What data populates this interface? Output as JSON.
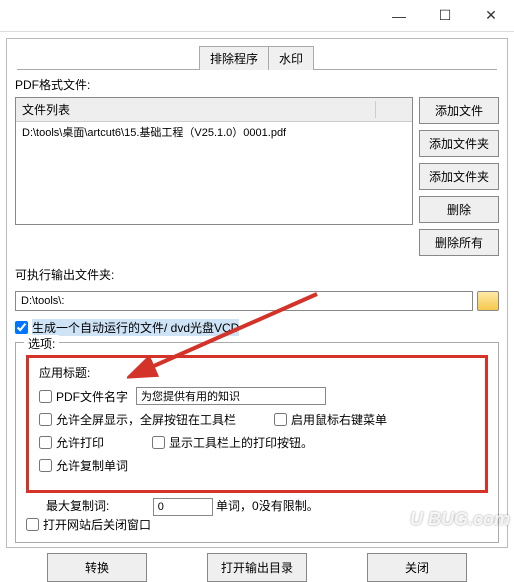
{
  "window": {
    "min": "—",
    "max": "☐",
    "close": "✕"
  },
  "tabs": {
    "exclude": "排除程序",
    "watermark": "水印"
  },
  "labels": {
    "pdfFile": "PDF格式文件:",
    "fileListHeader": "文件列表",
    "outputDir": "可执行输出文件夹:",
    "options": "选项:",
    "appTitle": "应用标题:",
    "maxCopy": "最大复制词:",
    "maxCopyTail": "单词，0没有限制。"
  },
  "filelist": {
    "row1": "D:\\tools\\桌面\\artcut6\\15.基础工程（V25.1.0）0001.pdf"
  },
  "sideButtons": {
    "addFile": "添加文件",
    "addFolder": "添加文件夹",
    "addFolder2": "添加文件夹",
    "delete": "删除",
    "deleteAll": "删除所有"
  },
  "output": {
    "path": "D:\\tools\\:"
  },
  "checkboxes": {
    "autorun": "生成一个自动运行的文件/ dvd光盘VCD",
    "pdfName": "PDF文件名字",
    "fullscreen": "允许全屏显示，全屏按钮在工具栏",
    "rightClick": "启用鼠标右键菜单",
    "allowPrint": "允许打印",
    "showPrintBtn": "显示工具栏上的打印按钮。",
    "allowCopy": "允许复制单词",
    "closeAfterOpen": "打开网站后关闭窗口"
  },
  "inputs": {
    "appTitleValue": "为您提供有用的知识",
    "maxCopyValue": "0"
  },
  "bottom": {
    "convert": "转换",
    "openOutput": "打开输出目录",
    "close": "关闭"
  },
  "watermark": "U BUG.com"
}
